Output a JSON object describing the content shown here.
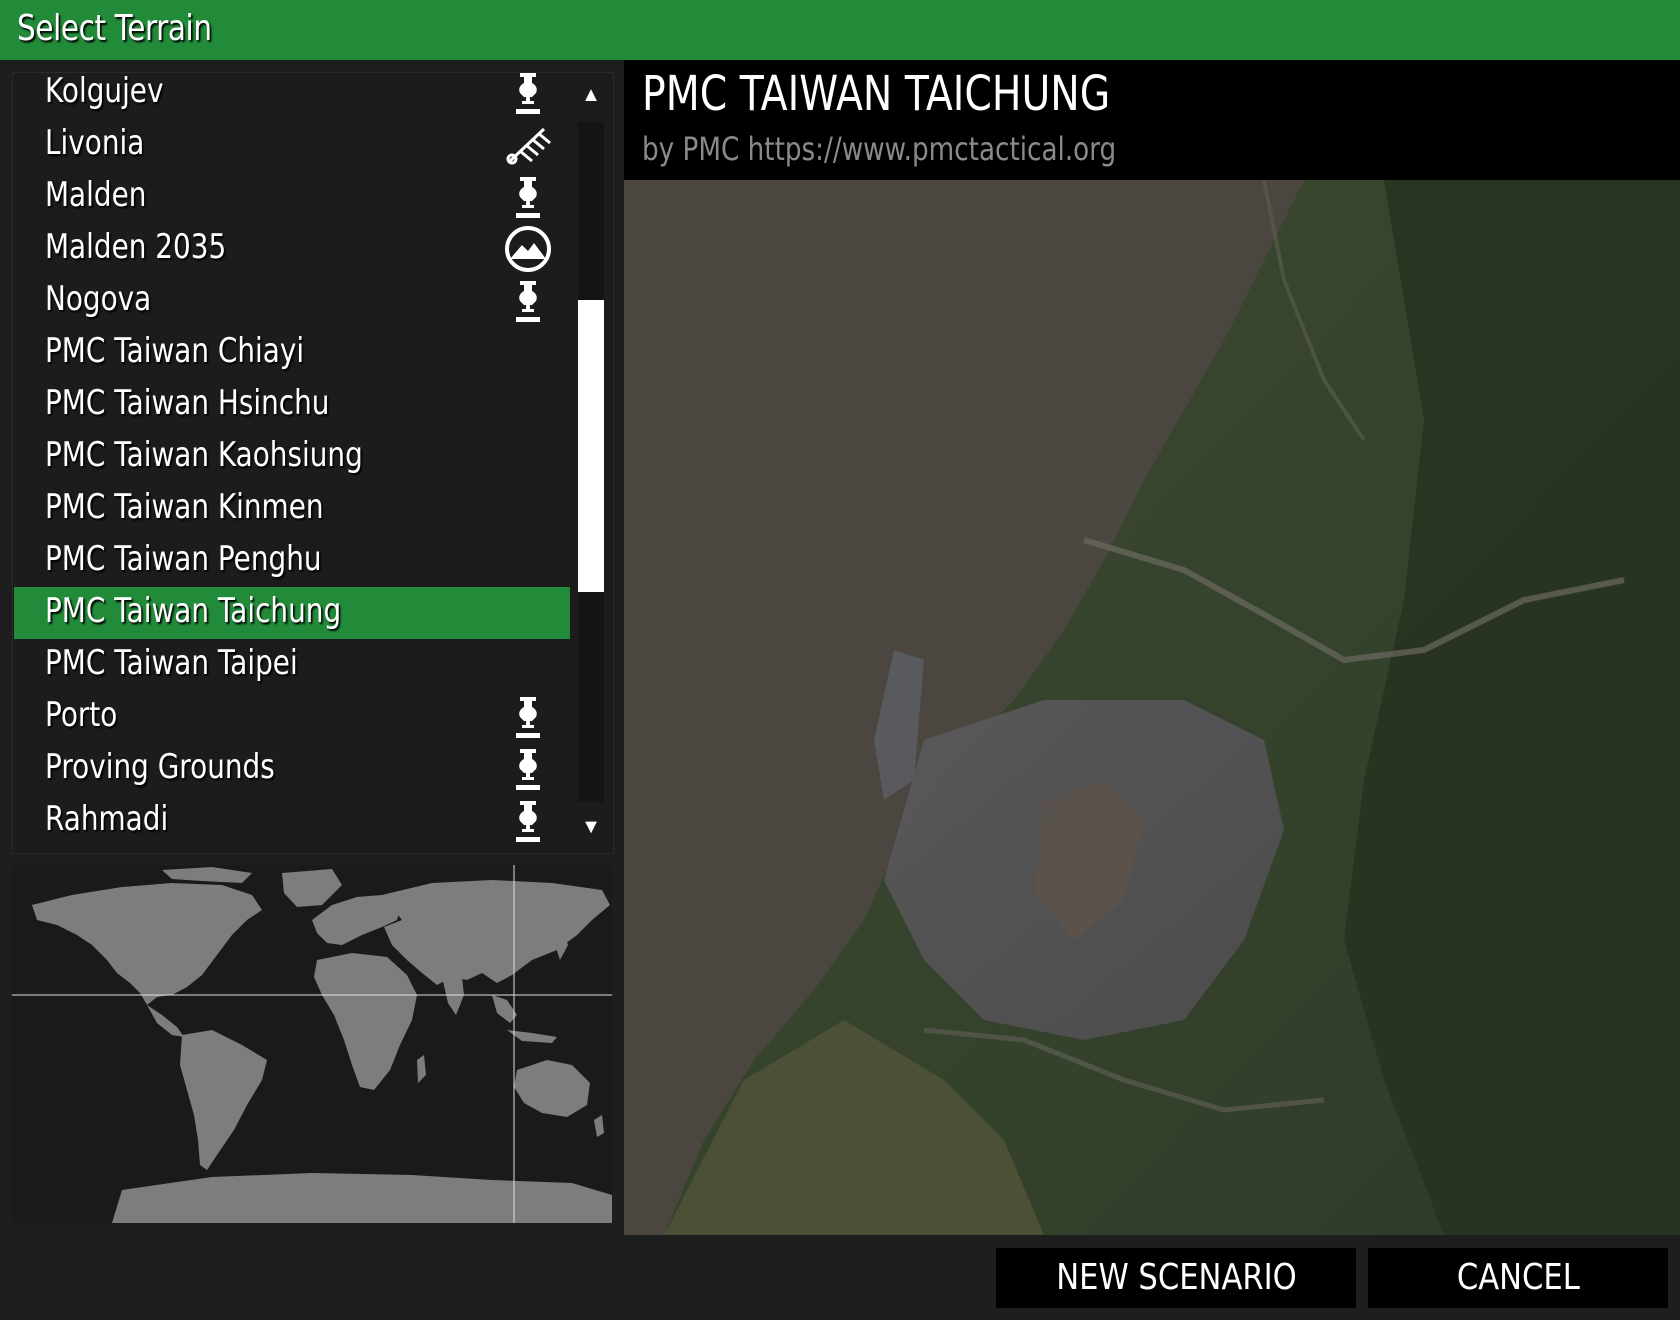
{
  "window": {
    "title": "Select Terrain"
  },
  "terrain_list": {
    "items": [
      {
        "label": "Kolgujev",
        "icon": "gm-emblem-icon",
        "selected": false
      },
      {
        "label": "Livonia",
        "icon": "contact-antenna-icon",
        "selected": false
      },
      {
        "label": "Malden",
        "icon": "gm-emblem-icon",
        "selected": false
      },
      {
        "label": "Malden 2035",
        "icon": "mountain-circle-icon",
        "selected": false
      },
      {
        "label": "Nogova",
        "icon": "gm-emblem-icon",
        "selected": false
      },
      {
        "label": "PMC Taiwan Chiayi",
        "icon": "",
        "selected": false
      },
      {
        "label": "PMC Taiwan Hsinchu",
        "icon": "",
        "selected": false
      },
      {
        "label": "PMC Taiwan Kaohsiung",
        "icon": "",
        "selected": false
      },
      {
        "label": "PMC Taiwan Kinmen",
        "icon": "",
        "selected": false
      },
      {
        "label": "PMC Taiwan Penghu",
        "icon": "",
        "selected": false
      },
      {
        "label": "PMC Taiwan Taichung",
        "icon": "",
        "selected": true
      },
      {
        "label": "PMC Taiwan Taipei",
        "icon": "",
        "selected": false
      },
      {
        "label": "Porto",
        "icon": "gm-emblem-icon",
        "selected": false
      },
      {
        "label": "Proving Grounds",
        "icon": "gm-emblem-icon",
        "selected": false
      },
      {
        "label": "Rahmadi",
        "icon": "gm-emblem-icon",
        "selected": false
      }
    ],
    "scroll_up_glyph": "▲",
    "scroll_down_glyph": "▼"
  },
  "preview": {
    "title": "PMC TAIWAN TAICHUNG",
    "author": "by PMC https://www.pmctactical.org"
  },
  "buttons": {
    "new_scenario": "NEW SCENARIO",
    "cancel": "CANCEL"
  },
  "colors": {
    "accent": "#228b3a",
    "panel": "#1c1c1c",
    "sea": "#4a4540"
  }
}
